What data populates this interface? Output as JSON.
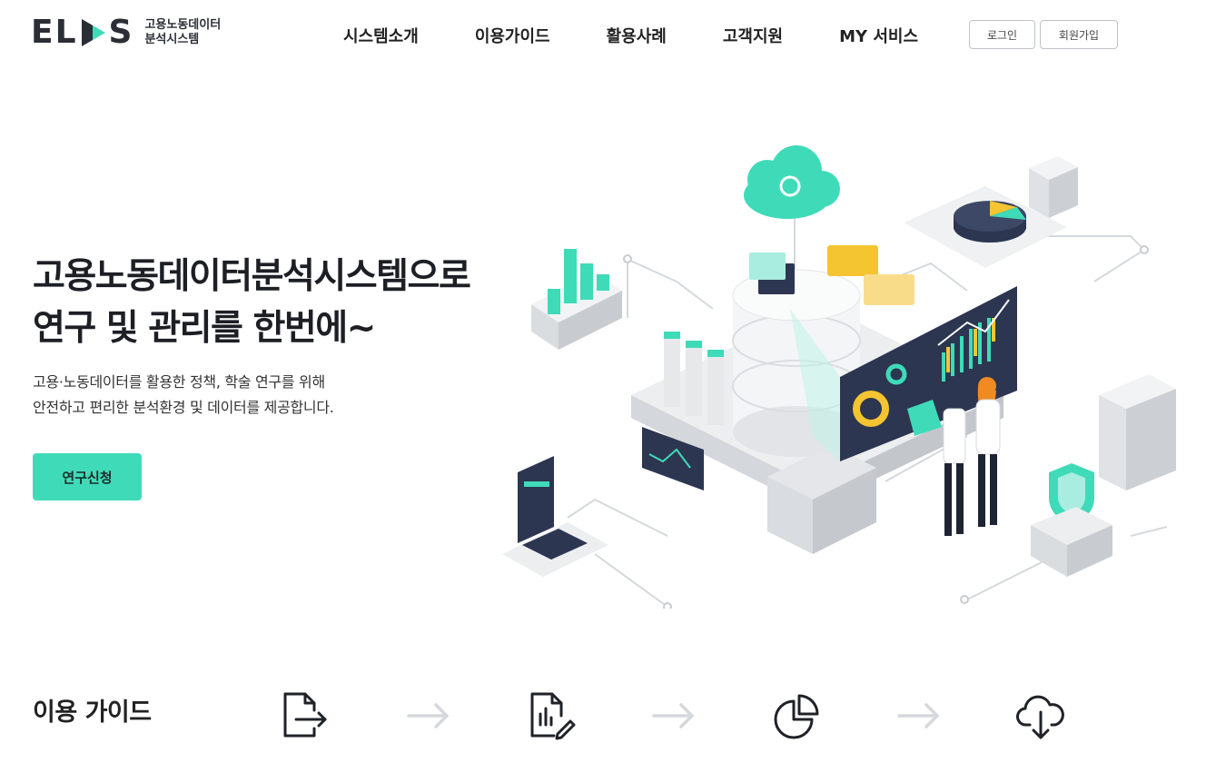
{
  "logo": {
    "mark": "ELDS",
    "subtitle_line1": "고용노동데이터",
    "subtitle_line2": "분석시스템",
    "colors": {
      "dark": "#2b2e36",
      "accent": "#3fdbb9"
    }
  },
  "nav": {
    "items": [
      {
        "label": "시스템소개"
      },
      {
        "label": "이용가이드"
      },
      {
        "label": "활용사례"
      },
      {
        "label": "고객지원"
      },
      {
        "label": "MY 서비스"
      }
    ],
    "login": "로그인",
    "signup": "회원가입"
  },
  "hero": {
    "title_line1": "고용노동데이터분석시스템으로",
    "title_line2": "연구 및 관리를 한번에~",
    "desc_line1": "고용·노동데이터를 활용한 정책, 학술 연구를 위해",
    "desc_line2": "안전하고 편리한 분석환경 및 데이터를 제공합니다.",
    "cta": "연구신청"
  },
  "guide": {
    "title": "이용 가이드",
    "steps": [
      {
        "icon": "file-export-icon"
      },
      {
        "icon": "document-edit-icon"
      },
      {
        "icon": "pie-chart-icon"
      },
      {
        "icon": "cloud-download-icon"
      }
    ]
  },
  "theme": {
    "accent": "#3fdbb9",
    "navy": "#2c3650",
    "yellow": "#f5c431"
  }
}
